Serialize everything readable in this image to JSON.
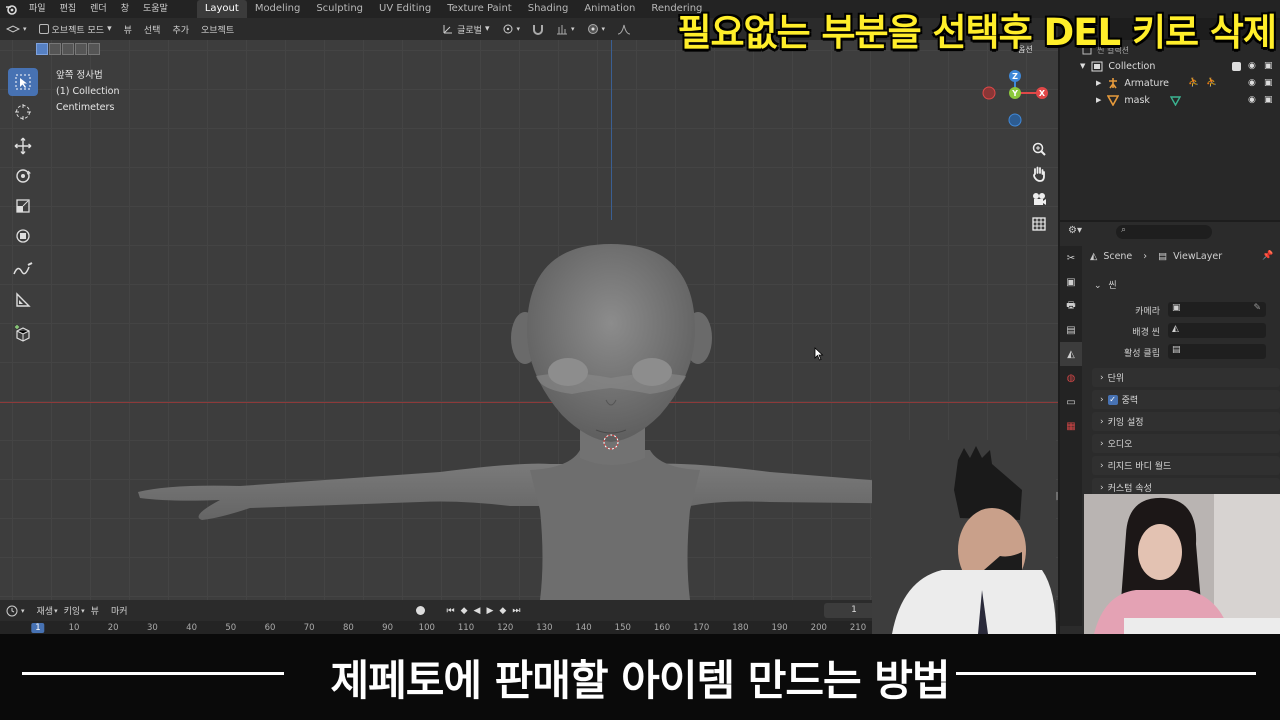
{
  "menubar": {
    "items": [
      "파일",
      "편집",
      "렌더",
      "창",
      "도움말"
    ],
    "workspaces": [
      "Layout",
      "Modeling",
      "Sculpting",
      "UV Editing",
      "Texture Paint",
      "Shading",
      "Animation",
      "Rendering"
    ],
    "active_workspace": "Layout",
    "scene_label": "Scene",
    "viewlayer_label": "ViewLayer"
  },
  "overlay_top_caption": "필요없는 부분을 선택후 DEL 키로 삭제",
  "viewport_header": {
    "mode": "오브젝트 모드",
    "menus": [
      "뷰",
      "선택",
      "추가",
      "오브젝트"
    ],
    "transform_orientation": "글로벌",
    "options": "옵션"
  },
  "viewport_info": {
    "view": "앞쪽 정사법",
    "collection": "(1) Collection",
    "units": "Centimeters"
  },
  "gizmo": {
    "x": "X",
    "y": "Y",
    "z": "Z"
  },
  "timeline": {
    "menus": [
      "재생",
      "키잉",
      "뷰",
      "마커"
    ],
    "current_frame": "1",
    "ticks": [
      "1",
      "10",
      "20",
      "30",
      "40",
      "50",
      "60",
      "70",
      "80",
      "90",
      "100",
      "110",
      "120",
      "130",
      "140",
      "150",
      "160",
      "170",
      "180",
      "190",
      "200",
      "210"
    ]
  },
  "outliner": {
    "scene_collection": "씬 컬렉션",
    "items": [
      {
        "label": "Collection",
        "level": 0
      },
      {
        "label": "Armature",
        "level": 1
      },
      {
        "label": "mask",
        "level": 1
      }
    ]
  },
  "properties": {
    "breadcrumb": [
      "Scene",
      "ViewLayer"
    ],
    "section_scene": "씬",
    "fields": [
      {
        "label": "카메라"
      },
      {
        "label": "배경 씬"
      },
      {
        "label": "활성 클립"
      }
    ],
    "panels": [
      "단위",
      "중력",
      "키잉 설정",
      "오디오",
      "리지드 바디 월드",
      "커스텀 속성"
    ],
    "gravity_checked": true
  },
  "bottom_caption": "제페토에 판매할 아이템 만드는 방법",
  "colors": {
    "accent": "#4772b3",
    "caption_yellow": "#ffee2a",
    "axis_red": "#e04848",
    "axis_green": "#8cc83c",
    "axis_blue": "#3f88d8"
  }
}
